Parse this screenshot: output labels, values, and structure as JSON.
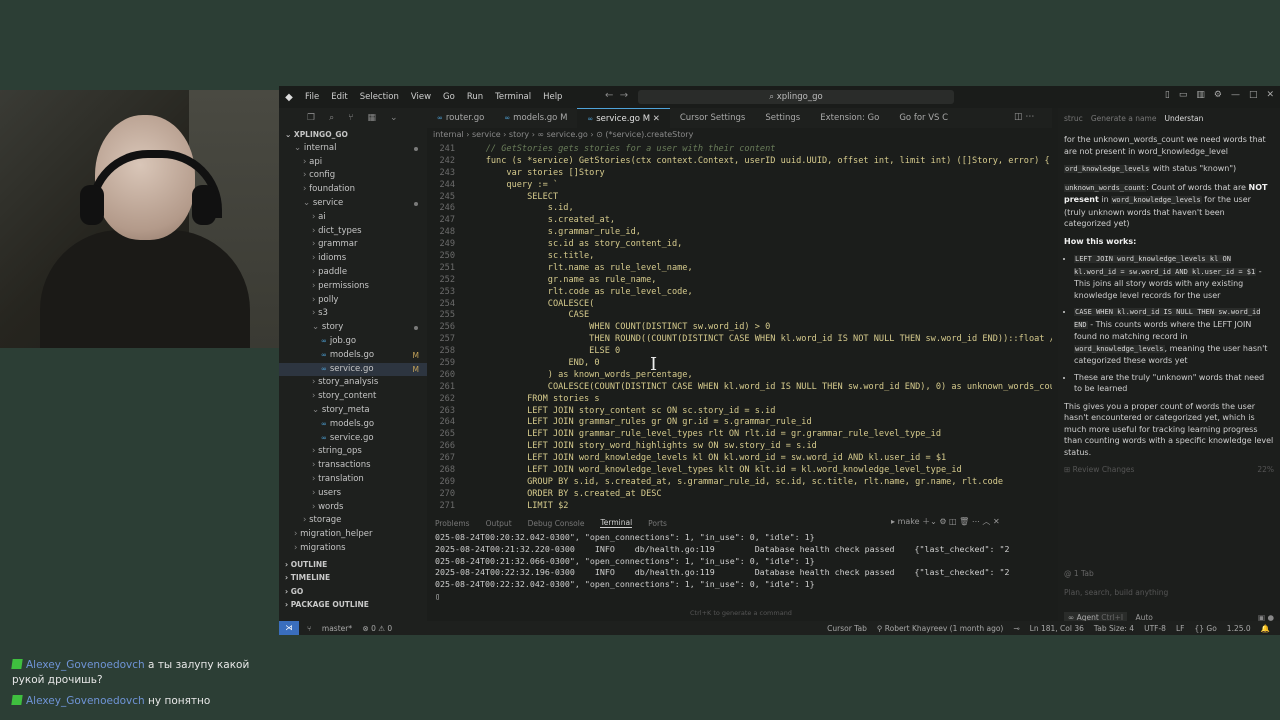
{
  "app": {
    "title": "xplingo_go",
    "menu": [
      "File",
      "Edit",
      "Selection",
      "View",
      "Go",
      "Run",
      "Terminal",
      "Help"
    ]
  },
  "sidebar": {
    "root": "XPLINGO_GO",
    "items": [
      {
        "label": "internal",
        "indent": 1,
        "kind": "folder-open",
        "dot": true
      },
      {
        "label": "api",
        "indent": 2,
        "kind": "folder"
      },
      {
        "label": "config",
        "indent": 2,
        "kind": "folder"
      },
      {
        "label": "foundation",
        "indent": 2,
        "kind": "folder"
      },
      {
        "label": "service",
        "indent": 2,
        "kind": "folder-open",
        "dot": true
      },
      {
        "label": "ai",
        "indent": 3,
        "kind": "folder"
      },
      {
        "label": "dict_types",
        "indent": 3,
        "kind": "folder"
      },
      {
        "label": "grammar",
        "indent": 3,
        "kind": "folder"
      },
      {
        "label": "idioms",
        "indent": 3,
        "kind": "folder"
      },
      {
        "label": "paddle",
        "indent": 3,
        "kind": "folder"
      },
      {
        "label": "permissions",
        "indent": 3,
        "kind": "folder"
      },
      {
        "label": "polly",
        "indent": 3,
        "kind": "folder"
      },
      {
        "label": "s3",
        "indent": 3,
        "kind": "folder"
      },
      {
        "label": "story",
        "indent": 3,
        "kind": "folder-open",
        "dot": true
      },
      {
        "label": "job.go",
        "indent": 4,
        "kind": "go"
      },
      {
        "label": "models.go",
        "indent": 4,
        "kind": "go",
        "badge": "M"
      },
      {
        "label": "service.go",
        "indent": 4,
        "kind": "go",
        "badge": "M",
        "selected": true
      },
      {
        "label": "story_analysis",
        "indent": 3,
        "kind": "folder"
      },
      {
        "label": "story_content",
        "indent": 3,
        "kind": "folder"
      },
      {
        "label": "story_meta",
        "indent": 3,
        "kind": "folder-open"
      },
      {
        "label": "models.go",
        "indent": 4,
        "kind": "go"
      },
      {
        "label": "service.go",
        "indent": 4,
        "kind": "go"
      },
      {
        "label": "string_ops",
        "indent": 3,
        "kind": "folder"
      },
      {
        "label": "transactions",
        "indent": 3,
        "kind": "folder"
      },
      {
        "label": "translation",
        "indent": 3,
        "kind": "folder"
      },
      {
        "label": "users",
        "indent": 3,
        "kind": "folder"
      },
      {
        "label": "words",
        "indent": 3,
        "kind": "folder"
      },
      {
        "label": "storage",
        "indent": 2,
        "kind": "folder"
      },
      {
        "label": "migration_helper",
        "indent": 1,
        "kind": "folder"
      },
      {
        "label": "migrations",
        "indent": 1,
        "kind": "folder"
      }
    ],
    "panels": [
      "OUTLINE",
      "TIMELINE",
      "GO",
      "PACKAGE OUTLINE"
    ]
  },
  "tabs": [
    {
      "label": "router.go",
      "go": true
    },
    {
      "label": "models.go M",
      "go": true
    },
    {
      "label": "service.go M",
      "go": true,
      "active": true
    },
    {
      "label": "Cursor Settings"
    },
    {
      "label": "Settings"
    },
    {
      "label": "Extension: Go"
    },
    {
      "label": "Go for VS C"
    }
  ],
  "breadcrumb": "internal › service › story › ∞ service.go › ⊙ (*service).createStory",
  "code": [
    {
      "n": "241",
      "t": "    // GetStories gets stories for a user with their content",
      "cls": "cmt"
    },
    {
      "n": "242",
      "t": "    func (s *service) GetStories(ctx context.Context, userID uuid.UUID, offset int, limit int) ([]Story, error) {"
    },
    {
      "n": "243",
      "t": "        var stories []Story"
    },
    {
      "n": "244",
      "t": "        query := `"
    },
    {
      "n": "245",
      "t": "            SELECT"
    },
    {
      "n": "246",
      "t": "                s.id,"
    },
    {
      "n": "247",
      "t": "                s.created_at,"
    },
    {
      "n": "248",
      "t": "                s.grammar_rule_id,"
    },
    {
      "n": "249",
      "t": "                sc.id as story_content_id,"
    },
    {
      "n": "250",
      "t": "                sc.title,"
    },
    {
      "n": "251",
      "t": "                rlt.name as rule_level_name,"
    },
    {
      "n": "252",
      "t": "                gr.name as rule_name,"
    },
    {
      "n": "253",
      "t": "                rlt.code as rule_level_code,"
    },
    {
      "n": "254",
      "t": "                COALESCE("
    },
    {
      "n": "255",
      "t": "                    CASE"
    },
    {
      "n": "256",
      "t": "                        WHEN COUNT(DISTINCT sw.word_id) > 0"
    },
    {
      "n": "257",
      "t": "                        THEN ROUND((COUNT(DISTINCT CASE WHEN kl.word_id IS NOT NULL THEN sw.word_id END))::float /"
    },
    {
      "n": "258",
      "t": "                        ELSE 0"
    },
    {
      "n": "259",
      "t": "                    END, 0"
    },
    {
      "n": "260",
      "t": "                ) as known_words_percentage,"
    },
    {
      "n": "261",
      "t": "                COALESCE(COUNT(DISTINCT CASE WHEN kl.word_id IS NULL THEN sw.word_id END), 0) as unknown_words_cou"
    },
    {
      "n": "262",
      "t": "            FROM stories s"
    },
    {
      "n": "263",
      "t": "            LEFT JOIN story_content sc ON sc.story_id = s.id"
    },
    {
      "n": "264",
      "t": "            LEFT JOIN grammar_rules gr ON gr.id = s.grammar_rule_id"
    },
    {
      "n": "265",
      "t": "            LEFT JOIN grammar_rule_level_types rlt ON rlt.id = gr.grammar_rule_level_type_id"
    },
    {
      "n": "266",
      "t": "            LEFT JOIN story_word_highlights sw ON sw.story_id = s.id"
    },
    {
      "n": "267",
      "t": "            LEFT JOIN word_knowledge_levels kl ON kl.word_id = sw.word_id AND kl.user_id = $1"
    },
    {
      "n": "268",
      "t": "            LEFT JOIN word_knowledge_level_types klt ON klt.id = kl.word_knowledge_level_type_id"
    },
    {
      "n": "269",
      "t": "            GROUP BY s.id, s.created_at, s.grammar_rule_id, sc.id, sc.title, rlt.name, gr.name, rlt.code"
    },
    {
      "n": "270",
      "t": "            ORDER BY s.created_at DESC"
    },
    {
      "n": "271",
      "t": "            LIMIT $2"
    }
  ],
  "terminal": {
    "tabs": [
      "Problems",
      "Output",
      "Debug Console",
      "Terminal",
      "Ports"
    ],
    "profile": "make",
    "lines": [
      "025-08-24T00:20:32.042-0300\", \"open_connections\": 1, \"in_use\": 0, \"idle\": 1}",
      "2025-08-24T00:21:32.220-0300    INFO    db/health.go:119        Database health check passed    {\"last_checked\": \"2",
      "025-08-24T00:21:32.066-0300\", \"open_connections\": 1, \"in_use\": 0, \"idle\": 1}",
      "2025-08-24T00:22:32.196-0300    INFO    db/health.go:119        Database health check passed    {\"last_checked\": \"2",
      "025-08-24T00:22:32.042-0300\", \"open_connections\": 1, \"in_use\": 0, \"idle\": 1}",
      "▯"
    ],
    "hint": "Ctrl+K to generate a command"
  },
  "chat": {
    "tabs": [
      "struc",
      "Generate a name",
      "Understan"
    ],
    "intro": "for the unknown_words_count we need words that are not present in word_knowledge_level",
    "line2_code": "ord_knowledge_levels",
    "line2_text": " with status \"known\")",
    "bullet_code": "unknown_words_count",
    "bullet_text1": ": Count of words that are ",
    "bullet_bold": "NOT present",
    "bullet_text2": " in ",
    "bullet_code2": "word_knowledge_levels",
    "bullet_text3": " for the user (truly unknown words that haven't been categorized yet)",
    "how_title": "How this works:",
    "list": [
      {
        "code": "LEFT JOIN word_knowledge_levels kl ON kl.word_id = sw.word_id AND kl.user_id = $1",
        "text": " - This joins all story words with any existing knowledge level records for the user"
      },
      {
        "code": "CASE WHEN kl.word_id IS NULL THEN sw.word_id END",
        "text": " - This counts words where the LEFT JOIN found no matching record in ",
        "code2": "word_knowledge_levels",
        "text2": ", meaning the user hasn't categorized these words yet"
      },
      {
        "text": "These are the truly \"unknown\" words that need to be learned"
      }
    ],
    "summary": "This gives you a proper count of words the user hasn't encountered or categorized yet, which is much more useful for tracking learning progress than counting words with a specific knowledge level status.",
    "review": "Review Changes",
    "review_pct": "22%",
    "tab_count": "1 Tab",
    "input_placeholder": "Plan, search, build anything",
    "agent_label": "Agent",
    "agent_shortcut": "Ctrl+I",
    "auto_label": "Auto"
  },
  "status": {
    "branch": "master*",
    "problems": "⊗ 0 ⚠ 0",
    "cursor_tab": "Cursor Tab",
    "blame": "Robert Khayreev (1 month ago)",
    "position": "Ln 181, Col 36",
    "tab_size": "Tab Size: 4",
    "encoding": "UTF-8",
    "eol": "LF",
    "language": "Go",
    "go_version": "1.25.0"
  },
  "stream_chat": [
    {
      "user": "Alexey_Govenoedovch",
      "text": "а ты залупу какой рукой дрочишь?"
    },
    {
      "user": "Alexey_Govenoedovch",
      "text": "ну понятно"
    }
  ]
}
